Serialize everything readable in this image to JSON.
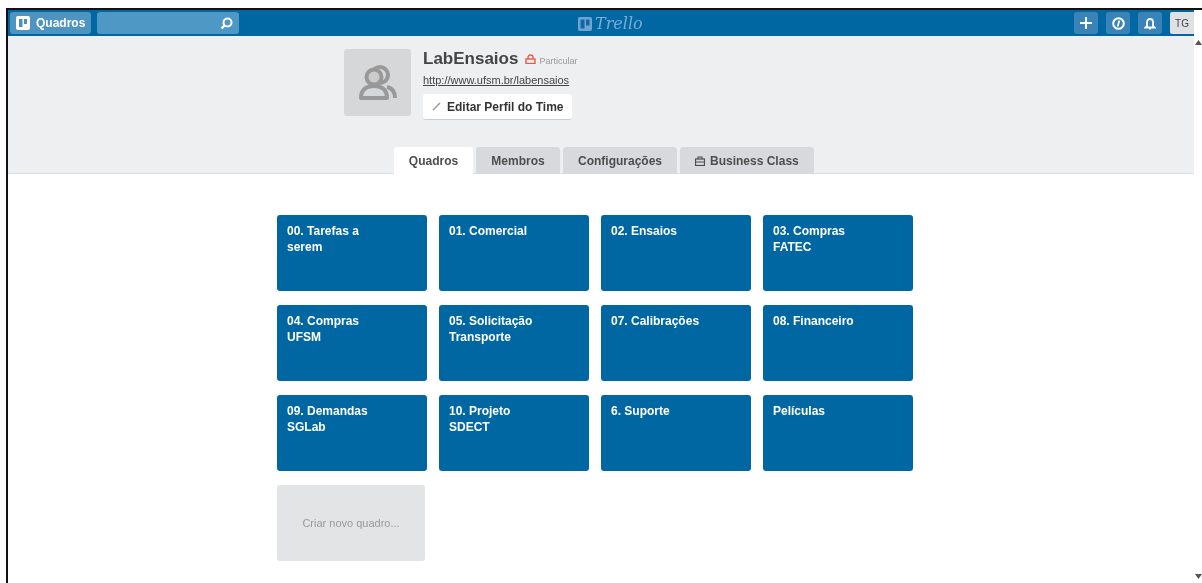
{
  "header": {
    "boards_button": "Quadros",
    "logo": "Trello",
    "avatar": "TG"
  },
  "team": {
    "name": "LabEnsaios",
    "privacy": "Particular",
    "url": "http://www.ufsm.br/labensaios",
    "edit_button": "Editar Perfil do Time"
  },
  "tabs": [
    {
      "label": "Quadros",
      "selected": true,
      "kind": "text"
    },
    {
      "label": "Membros",
      "selected": false,
      "kind": "text"
    },
    {
      "label": "Configurações",
      "selected": false,
      "kind": "text"
    },
    {
      "label": "Business Class",
      "selected": false,
      "kind": "briefcase"
    }
  ],
  "boards": [
    {
      "title": "00. Tarefas a serem"
    },
    {
      "title": "01. Comercial"
    },
    {
      "title": "02. Ensaios"
    },
    {
      "title": "03. Compras FATEC"
    },
    {
      "title": "04. Compras UFSM"
    },
    {
      "title": "05. Solicitação Transporte"
    },
    {
      "title": "07. Calibrações"
    },
    {
      "title": "08. Financeiro"
    },
    {
      "title": "09. Demandas SGLab"
    },
    {
      "title": "10. Projeto SDECT"
    },
    {
      "title": "6. Suporte"
    },
    {
      "title": "Películas"
    }
  ],
  "create_board": "Criar novo quadro..."
}
